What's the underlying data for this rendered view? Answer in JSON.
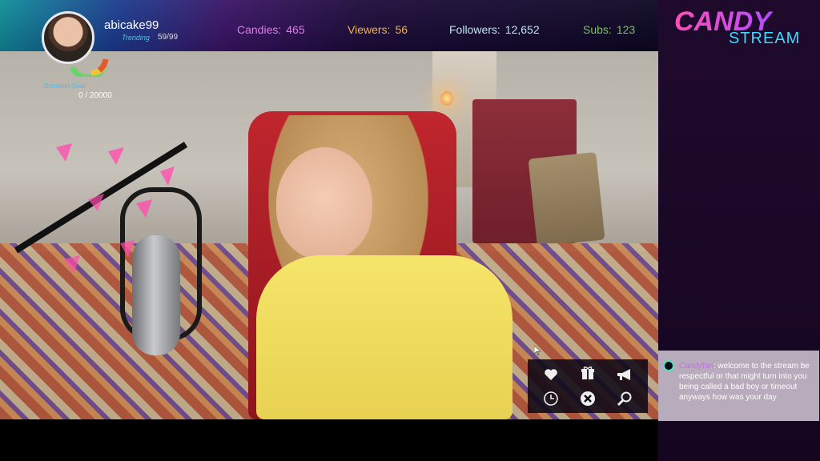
{
  "header": {
    "username": "abicake99",
    "trending_label": "Trending",
    "trending_count": "59/99",
    "stats": [
      {
        "label": "Candies:",
        "value": "465"
      },
      {
        "label": "Viewers:",
        "value": "56"
      },
      {
        "label": "Followers:",
        "value": "12,652"
      },
      {
        "label": "Subs:",
        "value": "123"
      }
    ]
  },
  "logo": {
    "line1": "CANDY",
    "line2": "STREAM"
  },
  "donation": {
    "label": "Donation Goal",
    "value": "0 / 20000"
  },
  "actions": [
    {
      "icon": "heart-icon"
    },
    {
      "icon": "gift-icon"
    },
    {
      "icon": "megaphone-icon"
    },
    {
      "icon": "clock-icon"
    },
    {
      "icon": "close-icon"
    },
    {
      "icon": "search-icon"
    }
  ],
  "chat": {
    "user": "Candyfan",
    "message": ": welcome to the stream be respectful or that might turn into you being called a bad boy or timeout anyways how was your day"
  },
  "colors": {
    "candies": "#e07ce8",
    "viewers": "#f2b34a",
    "followers": "#bfe7ef",
    "subs": "#7ec35a",
    "chat_bg": "#b8abbb"
  }
}
